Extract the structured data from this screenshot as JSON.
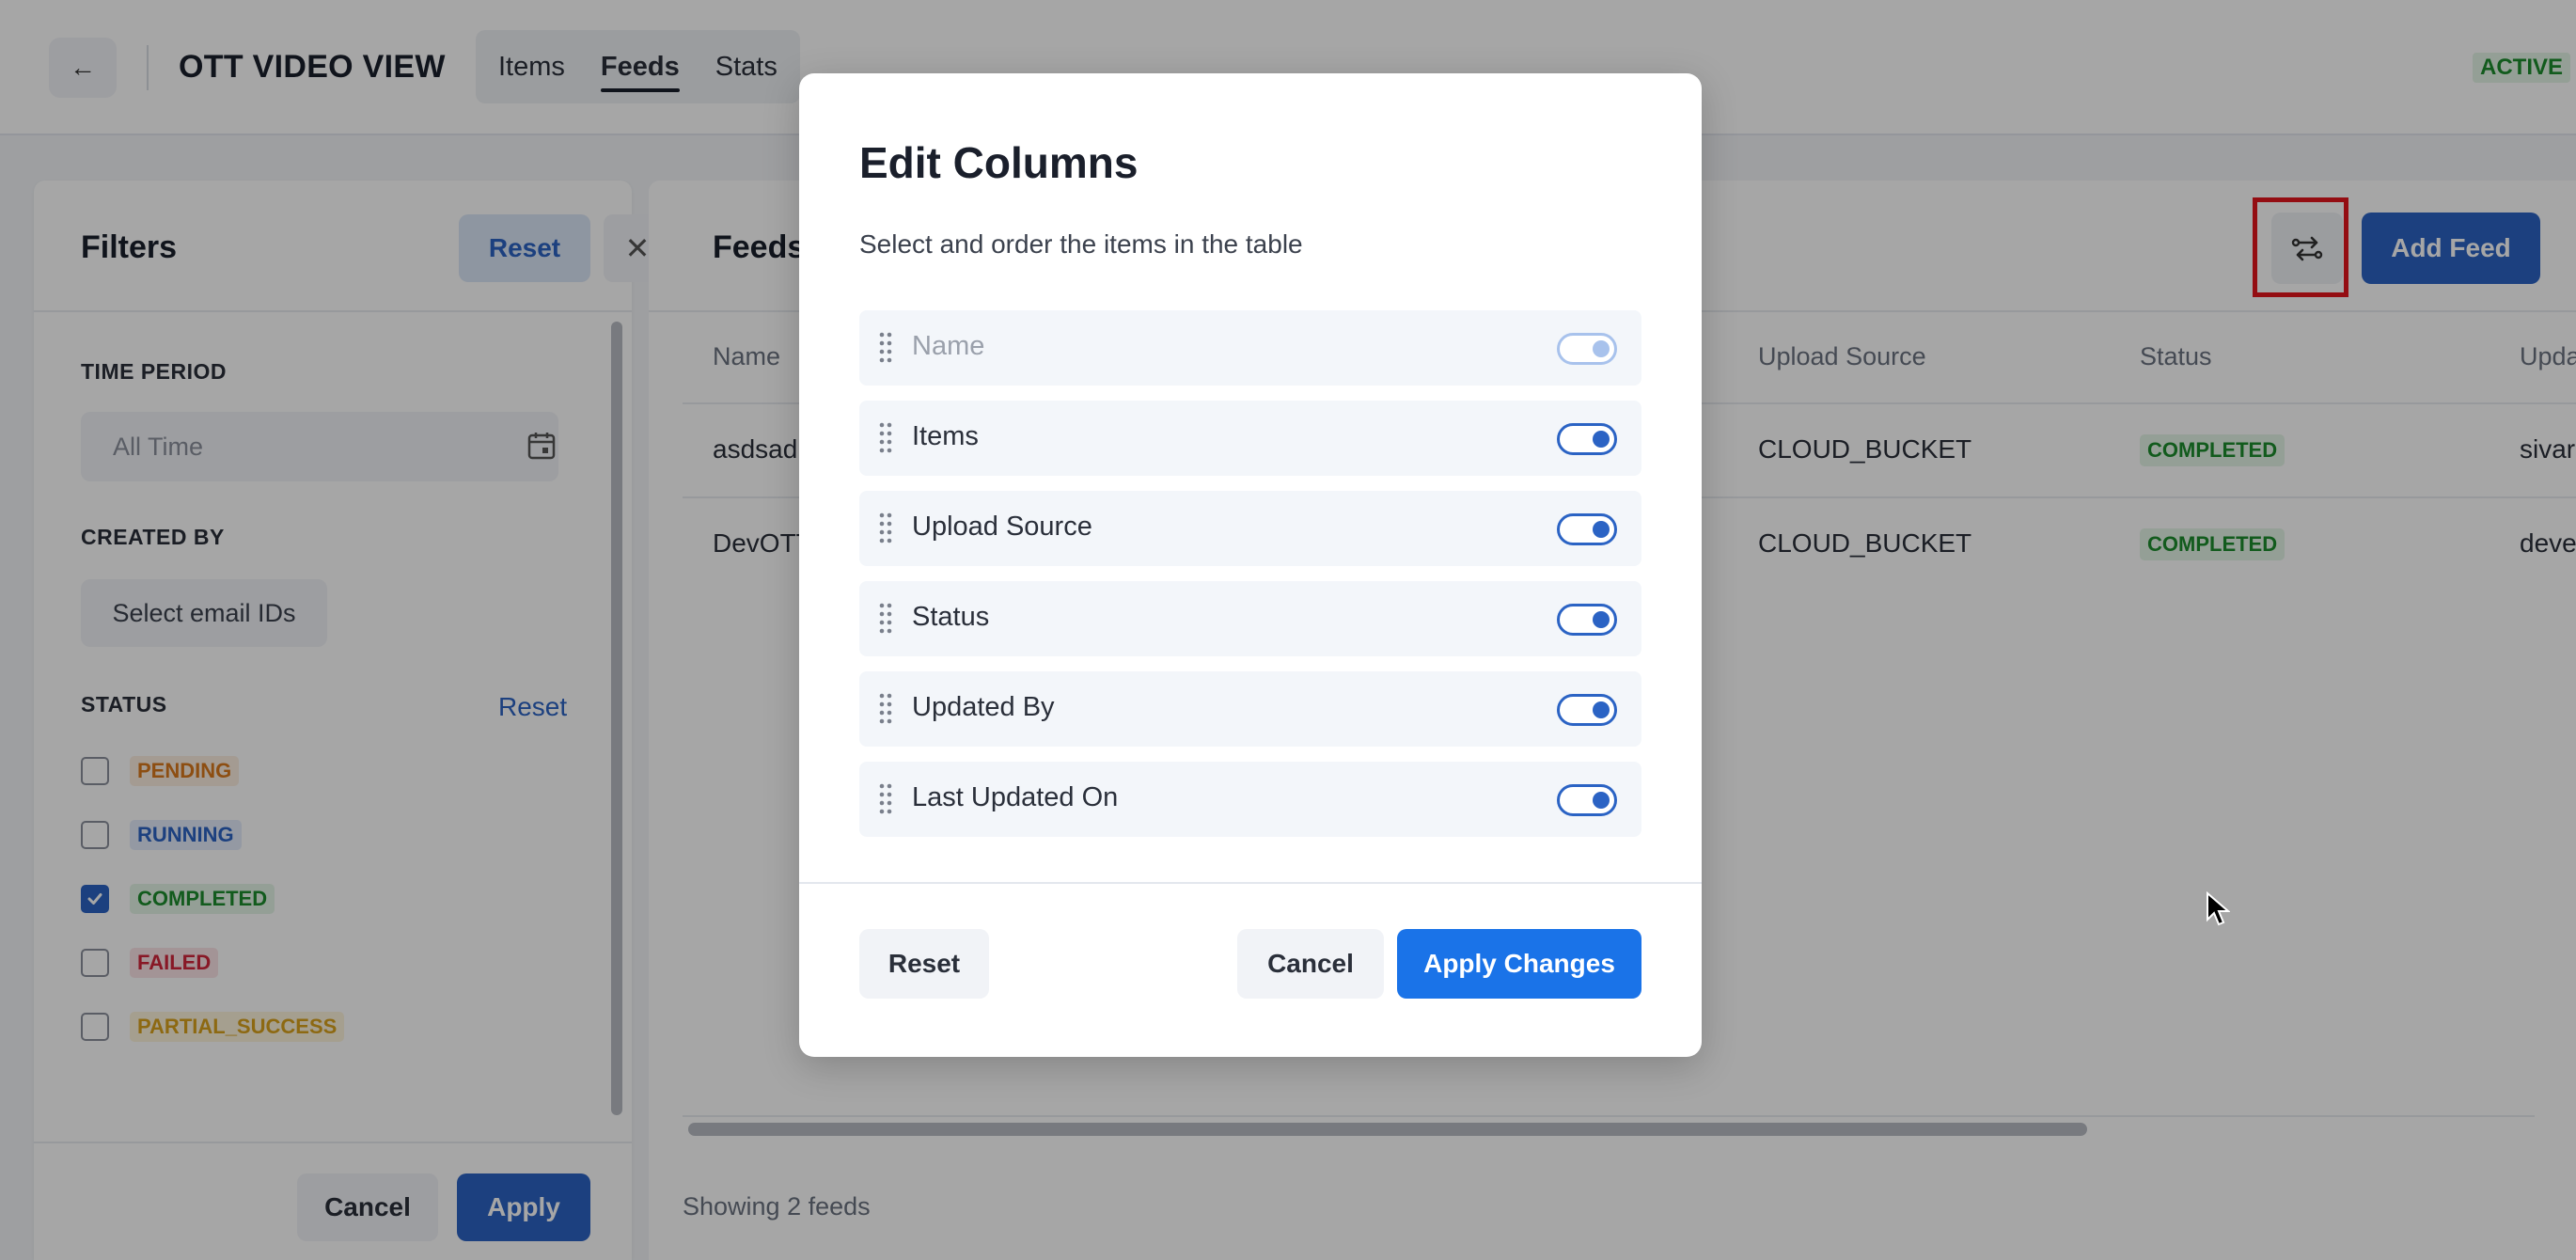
{
  "header": {
    "back_glyph": "←",
    "app_title": "OTT VIDEO VIEW",
    "tabs": [
      {
        "label": "Items",
        "active": false
      },
      {
        "label": "Feeds",
        "active": true
      },
      {
        "label": "Stats",
        "active": false
      }
    ],
    "badge": "ACTIVE"
  },
  "filters": {
    "title": "Filters",
    "reset_label": "Reset",
    "close_glyph": "✕",
    "time_period": {
      "label": "TIME PERIOD",
      "placeholder": "All Time"
    },
    "created_by": {
      "label": "CREATED BY",
      "placeholder": "Select email IDs"
    },
    "status": {
      "label": "STATUS",
      "reset_label": "Reset",
      "options": [
        {
          "label": "PENDING",
          "checked": false,
          "color": "#d9781c",
          "bg": "#fcefe0"
        },
        {
          "label": "RUNNING",
          "checked": false,
          "color": "#2b63c4",
          "bg": "#e3ecfa"
        },
        {
          "label": "COMPLETED",
          "checked": true,
          "color": "#1c8c2d",
          "bg": "#e4f5e6"
        },
        {
          "label": "FAILED",
          "checked": false,
          "color": "#d1263b",
          "bg": "#fbe4e7"
        },
        {
          "label": "PARTIAL_SUCCESS",
          "checked": false,
          "color": "#d9a21c",
          "bg": "#fdf4dc"
        }
      ]
    },
    "cancel_label": "Cancel",
    "apply_label": "Apply"
  },
  "feeds": {
    "title": "Feeds",
    "add_label": "Add Feed",
    "edit_columns_icon": "columns-reorder-icon",
    "columns": [
      "Name",
      "Upload Source",
      "Status",
      "Upda"
    ],
    "rows": [
      {
        "name": "asdsad",
        "upload_source": "CLOUD_BUCKET",
        "status": "COMPLETED",
        "updated_by": "sivar"
      },
      {
        "name": "DevOTT",
        "upload_source": "CLOUD_BUCKET",
        "status": "COMPLETED",
        "updated_by": "deve"
      }
    ],
    "footer": "Showing 2 feeds"
  },
  "modal": {
    "title": "Edit Columns",
    "subtitle": "Select and order the items in the table",
    "columns": [
      {
        "label": "Name",
        "enabled": true,
        "locked": true
      },
      {
        "label": "Items",
        "enabled": true,
        "locked": false
      },
      {
        "label": "Upload Source",
        "enabled": true,
        "locked": false
      },
      {
        "label": "Status",
        "enabled": true,
        "locked": false
      },
      {
        "label": "Updated By",
        "enabled": true,
        "locked": false
      },
      {
        "label": "Last Updated On",
        "enabled": true,
        "locked": false
      }
    ],
    "reset_label": "Reset",
    "cancel_label": "Cancel",
    "apply_label": "Apply Changes"
  },
  "colors": {
    "primary": "#2b63c4",
    "apply_primary": "#1a73e8",
    "highlight": "#e3141c",
    "success": "#1c8c2d"
  }
}
